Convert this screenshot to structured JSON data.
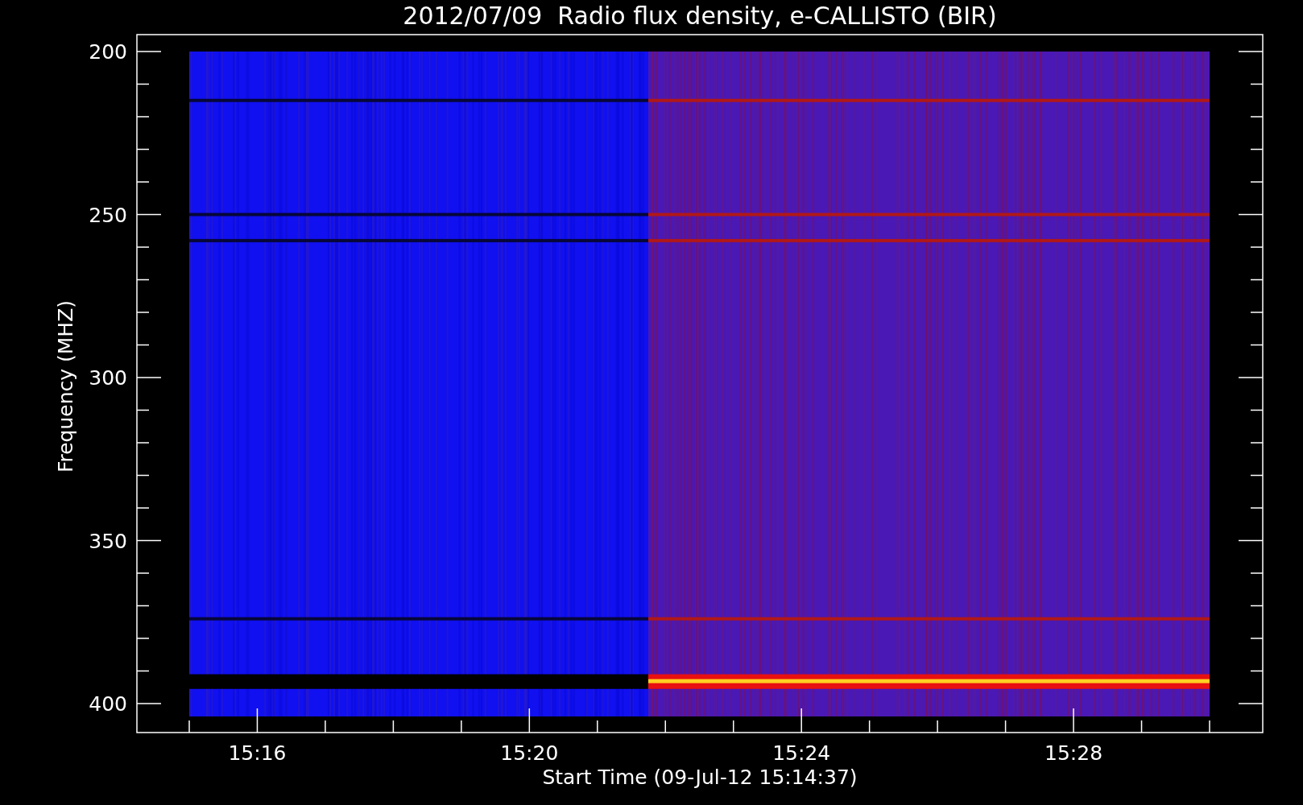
{
  "title": "2012/07/09  Radio flux density, e-CALLISTO (BIR)",
  "y_axis": {
    "label": "Frequency (MHZ)",
    "ticks": [
      "200",
      "250",
      "300",
      "350",
      "400"
    ]
  },
  "x_axis": {
    "label": "Start Time (09-Jul-12 15:14:37)",
    "ticks": [
      "15:16",
      "15:20",
      "15:24",
      "15:28"
    ]
  }
}
